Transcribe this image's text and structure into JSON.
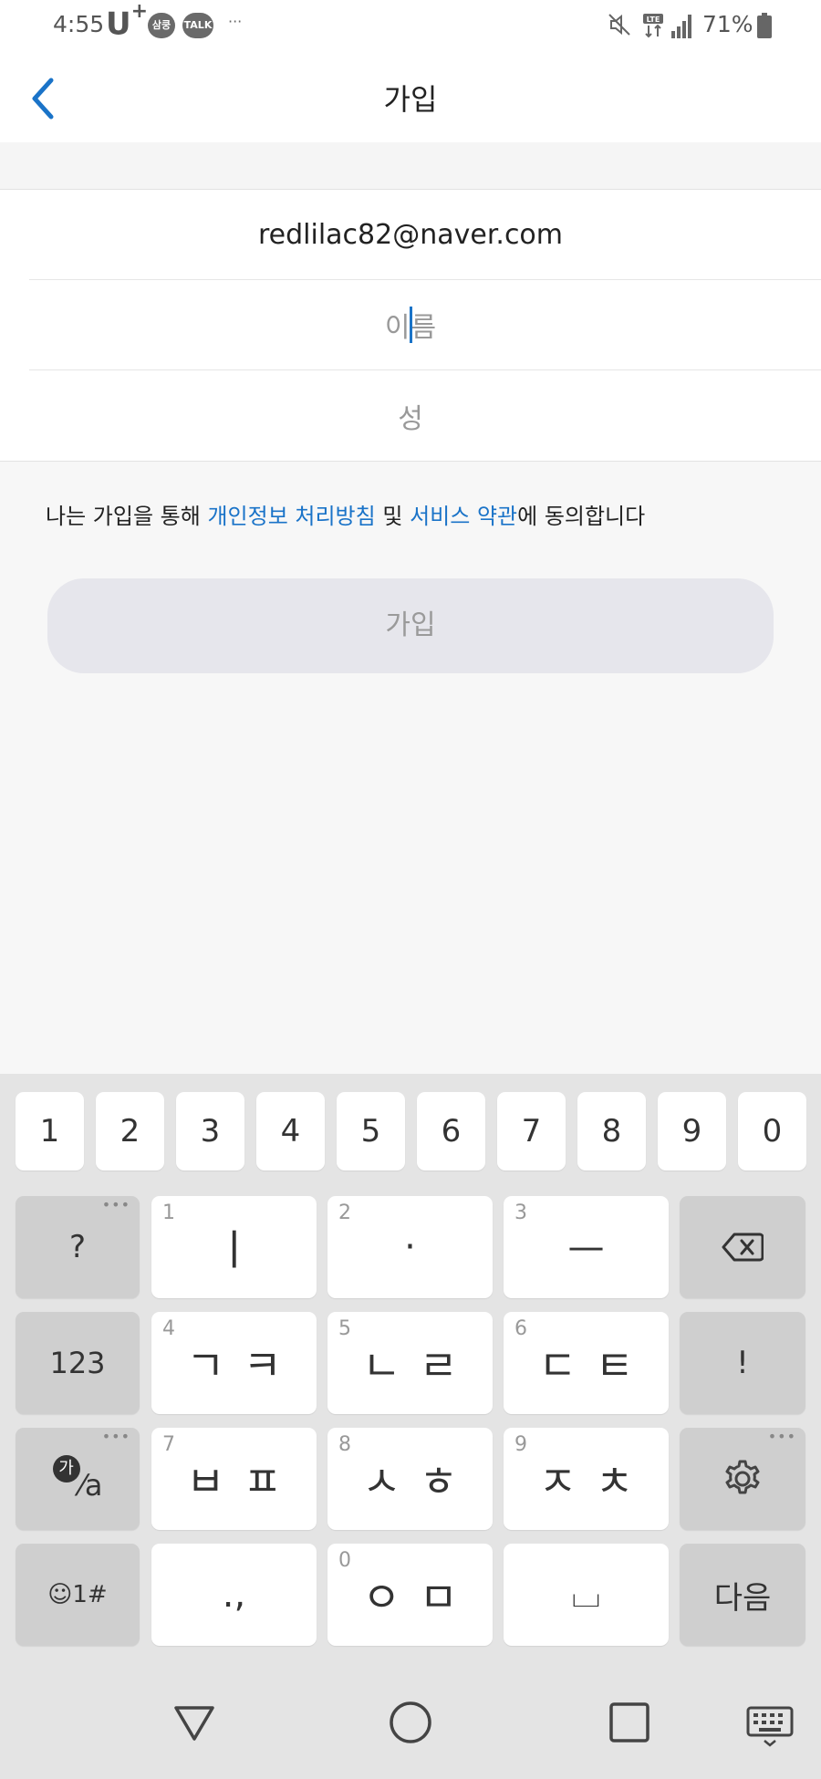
{
  "status_bar": {
    "time": "4:55",
    "carrier": "U",
    "carrier_sup": "+",
    "notif_1": "삼쿵",
    "notif_2": "TALK",
    "dots": "···",
    "battery": "71%"
  },
  "header": {
    "title": "가입",
    "back_icon": "chevron-left-icon"
  },
  "form": {
    "email_value": "redlilac82@naver.com",
    "first_name_placeholder_a": "이",
    "first_name_placeholder_b": "름",
    "last_name_placeholder": "성"
  },
  "terms": {
    "prefix": "나는 가입을 통해 ",
    "privacy_link": "개인정보 처리방침",
    "middle": " 및 ",
    "service_link": "서비스 약관",
    "suffix": "에 동의합니다"
  },
  "submit_label": "가입",
  "accent_color": "#1a73c8",
  "keyboard": {
    "number_row": [
      "1",
      "2",
      "3",
      "4",
      "5",
      "6",
      "7",
      "8",
      "9",
      "0"
    ],
    "row1": {
      "question": "?",
      "k1_hint": "1",
      "k1": "ㅣ",
      "k2_hint": "2",
      "k2": "·",
      "k3_hint": "3",
      "k3": "—",
      "backspace_icon": "backspace-icon"
    },
    "row2": {
      "mode": "123",
      "k1_hint": "4",
      "k1": "ㄱㅋ",
      "k2_hint": "5",
      "k2": "ㄴㄹ",
      "k3_hint": "6",
      "k3": "ㄷㅌ",
      "exclaim": "!"
    },
    "row3": {
      "lang_a": "가",
      "lang_b": "⁄a",
      "k1_hint": "7",
      "k1": "ㅂㅍ",
      "k2_hint": "8",
      "k2": "ㅅㅎ",
      "k3_hint": "9",
      "k3": "ㅈㅊ",
      "settings_icon": "gear-icon"
    },
    "row4": {
      "emoji": "☺1#",
      "k1": ".,",
      "k2_hint": "0",
      "k2": "ㅇㅁ",
      "space": "⌴",
      "next": "다음"
    },
    "more_dots": "•••"
  },
  "nav_bar": {
    "back": "triangle-back-icon",
    "home": "circle-home-icon",
    "recents": "square-recents-icon",
    "keyboard": "keyboard-icon"
  }
}
